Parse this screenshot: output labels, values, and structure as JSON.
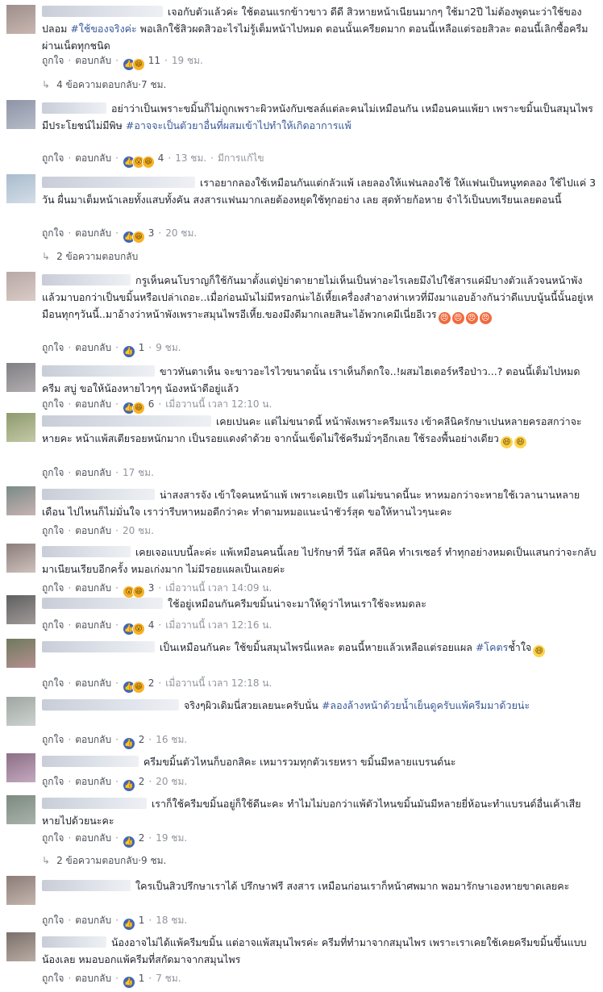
{
  "ui": {
    "like": "ถูกใจ",
    "reply": "ตอบกลับ",
    "dot": "·"
  },
  "comments": [
    {
      "segments": [
        {
          "t": "เจอกับตัวแล้วค่ะ ใช้ตอนแรกข้าวขาว ดีดี สิวหายหน้าเนียนมากๆ ใช้มา2ปี ไม่ต้องพูดนะว่าใช้ของปลอม "
        },
        {
          "t": "#ใช้ของจริงค่ะ",
          "h": true
        },
        {
          "t": " พอเลิกใช้สิวผดสิวอะไรไม่รู้เต็มหน้าไปหมด ตอนนั้นเครียดมาก ตอนนี้เหลือแต่รอยสิวละ ตอนนี้เลิกซื้อครีมผ่านเน็ตทุกชนิด"
        }
      ],
      "reactions": [
        "like",
        "haha"
      ],
      "count": "11",
      "time": "19 ชม.",
      "extra": "",
      "replies": "4 ข้อความตอบกลับ",
      "replies_time": "7 ชม."
    },
    {
      "segments": [
        {
          "t": "อย่าว่าเป็นเพราะขมิ้นก็ไม่ถูกเพราะผิวหนังกับเซลล์แต่ละคนไม่เหมือนกัน เหมือนคนแพ้ยา เพราะขมิ้นเป็นสมุนไพรมีประโยชน์ไม่มีพิษ "
        },
        {
          "t": "#อาจจะเป็นตัวยาอื่นที่ผสมเข้าไปทำให้เกิดอาการแพ้",
          "h": true
        }
      ],
      "reactions": [
        "like",
        "wow",
        "haha"
      ],
      "count": "4",
      "time": "13 ชม.",
      "extra": "มีการแก้ไข",
      "replies": "",
      "replies_time": ""
    },
    {
      "segments": [
        {
          "t": "เราอยากลองใช้เหมือนกันแต่กลัวแพ้ เลยลองให้แฟนลองใช้ ให้แฟนเป็นหนูทดลอง ใช้ไปแค่ 3 วัน ผื่นมาเต็มหน้าเลยทั้งแสบทั้งคัน สงสารแฟนมากเลยต้องหยุดใช้ทุกอย่าง เลย สุดท้ายก้อหาย จำไว้เป็นบทเรียนเลยตอนนี้"
        }
      ],
      "reactions": [
        "like",
        "haha"
      ],
      "count": "3",
      "time": "20 ชม.",
      "extra": "",
      "replies": "2 ข้อความตอบกลับ",
      "replies_time": ""
    },
    {
      "segments": [
        {
          "t": "กรูเห็นคนโบราญก็ใช้กันมาตั้งแต่ปู่ย่าตายายไม่เห็นเป็นห่าอะไรเลยมึงไปใช้สารแค่มีบางตัวแล้วจนหน้าพังแล้วมาบอกว่าเป็นขมิ้นหรือเปล่าเถอะ..เมื่อก่อนมันไม่มีหรอกน่ะไอ้เหี้ยเครื่องสำอางห่าเหวที่มึงมาแอบอ้างกันว่าดีแบบนู้นนี้นั้นอยู่เหมือนทุกๆวันนี้..มาอ้างว่าหน้าพังเพราะสมุนไพรอีเหี้ย.ของมึงดีมากเลยสินะไอ้พวกเคมีเนี่ยอีเวร"
        }
      ],
      "emojis": [
        "angry",
        "angry",
        "angry",
        "angry"
      ],
      "reactions": [
        "like"
      ],
      "count": "1",
      "time": "9 ชม.",
      "extra": "",
      "replies": "",
      "replies_time": ""
    },
    {
      "segments": [
        {
          "t": "ขาวทันตาเห็น จะขาวอะไรไวขนาดนั้น เราเห็นก็ตกใจ..!ผสมไฮเตอร์หรือป่าว...? ตอนนี้เต็มไปหมด ครีม สบู่ ขอให้น้องหายไวๆๆ น้องหน้าดีอยู่แล้ว"
        }
      ],
      "reactions": [
        "like",
        "haha"
      ],
      "count": "6",
      "time": "เมื่อวานนี้ เวลา 12:10 น.",
      "extra": "",
      "replies": "",
      "replies_time": ""
    },
    {
      "segments": [
        {
          "t": "เคยเปนคะ แต่ไม่ขนาดนี้ หน้าพังเพราะครีมแรง เข้าคลีนิครักษาเปนหลายครอสกว่าจะหายคะ หน้าแพ้สเตียรอยหนักมาก เป็นรอยแดงดำด้วย จากนั้นเข็ดไม่ใช้ครีมมั่วๆอีกเลย ใช้รองพื้นอย่างเดียว"
        }
      ],
      "emojis": [
        "smile",
        "smile"
      ],
      "reactions": [],
      "count": "",
      "time": "17 ชม.",
      "extra": "",
      "replies": "",
      "replies_time": ""
    },
    {
      "segments": [
        {
          "t": "น่าสงสารจัง เข้าใจคนหน้าแพ้ เพราะเคยเป๊ร แต่ไม่ขนาดนี้นะ หาหมอกว่าจะหายใช้เวลานานหลายเดือน ไปไหนก็ไม่มั่นใจ เราว่ารีบหาหมอดีกว่าคะ ทำตามหมอแนะนำชัวร์สุด ขอให้หานไวๆนะคะ"
        }
      ],
      "reactions": [],
      "count": "",
      "time": "20 ชม.",
      "extra": "",
      "replies": "",
      "replies_time": ""
    },
    {
      "segments": [
        {
          "t": "เคยเจอแบบนี้ละค่ะ แพ้เหมือนคนนี้เลย ไปรักษาที่ วีนัส คลีนิค ทำเรเซอร์ ทำทุกอย่างหมดเป็นแสนกว่าจะกลับมาเนียนเรียบอีกครั้ง หมอเก่งมาก ไม่มีรอยแผลเป็นเลยค่ะ"
        }
      ],
      "reactions": [
        "wow",
        "haha"
      ],
      "count": "3",
      "time": "เมื่อวานนี้ เวลา 14:09 น.",
      "extra": "",
      "replies": "",
      "replies_time": ""
    },
    {
      "segments": [
        {
          "t": "ใช้อยู่เหมือนกันครีมขมิ้นน่าจะมาให้ดูว่าไหนเราใช้จะหมดละ"
        }
      ],
      "reactions": [
        "like",
        "wow"
      ],
      "count": "4",
      "time": "เมื่อวานนี้ เวลา 12:16 น.",
      "extra": "",
      "replies": "",
      "replies_time": ""
    },
    {
      "segments": [
        {
          "t": "เป็นเหมือนกันคะ ใช้ขมิ้นสมุนไพรนี่แหละ ตอนนี้หายแล้วเหลือแต่รอยแผล "
        },
        {
          "t": "#โคตร",
          "h": true
        },
        {
          "t": "ช้ำใจ"
        }
      ],
      "emojis": [
        "smile"
      ],
      "reactions": [
        "like",
        "haha"
      ],
      "count": "2",
      "time": "เมื่อวานนี้ เวลา 12:18 น.",
      "extra": "",
      "replies": "",
      "replies_time": ""
    },
    {
      "segments": [
        {
          "t": "จริงๆผิวเดิมนี่สวยเลยนะครับนั่น "
        },
        {
          "t": "#ลองล้างหน้าด้วยน้ำเย็นดูครับแพ้ครีมมาด้วยน่ะ",
          "h": true
        }
      ],
      "reactions": [
        "like"
      ],
      "count": "2",
      "time": "16 ชม.",
      "extra": "",
      "replies": "",
      "replies_time": ""
    },
    {
      "segments": [
        {
          "t": "ครีมขมิ้นตัวไหนก็บอกสิคะ เหมารวมทุกตัวเรยหรา ขมิ้นมีหลายแบรนด์นะ"
        }
      ],
      "reactions": [
        "like"
      ],
      "count": "2",
      "time": "20 ชม.",
      "extra": "",
      "replies": "",
      "replies_time": ""
    },
    {
      "segments": [
        {
          "t": "เราก็ใช้ครีมขมิ้นอยู่ก็ใช้ดีนะคะ ทำไมไม่บอกว่าแพ้ตัวไหนขมิ้นมันมีหลายยี่ห้อนะทำแบรนด์อื่นเค้าเสียหายไปด้วยนะคะ"
        }
      ],
      "reactions": [
        "like"
      ],
      "count": "2",
      "time": "19 ชม.",
      "extra": "",
      "replies": "2 ข้อความตอบกลับ",
      "replies_time": "9 ชม."
    },
    {
      "segments": [
        {
          "t": "ใครเป็นสิวปรึกษาเราได้ ปรึกษาฟรี สงสาร เหมือนก่อนเราก็หน้าศพมาก พอมารักษาเองหายขาดเลยคะ"
        }
      ],
      "reactions": [
        "like"
      ],
      "count": "1",
      "time": "18 ชม.",
      "extra": "",
      "replies": "",
      "replies_time": ""
    },
    {
      "segments": [
        {
          "t": "น้องอาจไม่ได้แพ้ครีมขมิ้น แต่อาจแพ้สมุนไพรค่ะ ครีมที่ทำมาจากสมุนไพร เพราะเราเคยใช้เคยครีมขมิ้นขึ้นแบบน้องเลย หมอบอกแพ้ครีมที่สกัดมาจากสมุนไพร"
        }
      ],
      "reactions": [
        "like"
      ],
      "count": "1",
      "time": "7 ชม.",
      "extra": "",
      "replies": "",
      "replies_time": ""
    }
  ],
  "colors": {
    "link": "#365899",
    "meta": "#90949c",
    "text": "#1d2129"
  }
}
